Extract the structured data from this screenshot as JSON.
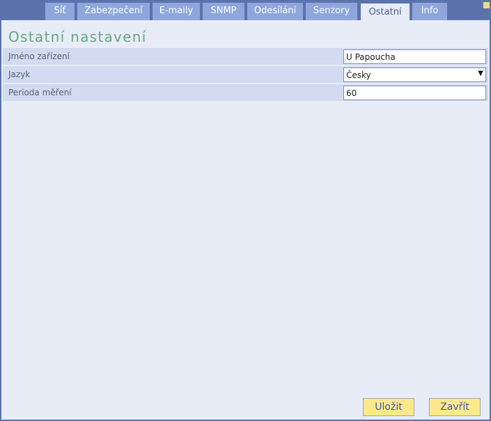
{
  "tabs": [
    "Síť",
    "Zabezpečení",
    "E-maily",
    "SNMP",
    "Odesílání",
    "Senzory",
    "Ostatní",
    "Info"
  ],
  "active_tab": "Ostatní",
  "page_title": "Ostatní nastavení",
  "form": {
    "device_name": {
      "label": "Jméno zařízení",
      "value": "U Papoucha"
    },
    "language": {
      "label": "Jazyk",
      "value": "Česky"
    },
    "period": {
      "label": "Perioda měření",
      "value": "60"
    }
  },
  "buttons": {
    "save": "Uložit",
    "close": "Zavřít"
  },
  "colors": {
    "frame": "#5b73ad",
    "tab": "#8ea6dc",
    "panel": "#e8ecf7",
    "row": "#d2dbef",
    "title": "#64a882",
    "button": "#fde98c",
    "corner": "#f3dc72"
  }
}
